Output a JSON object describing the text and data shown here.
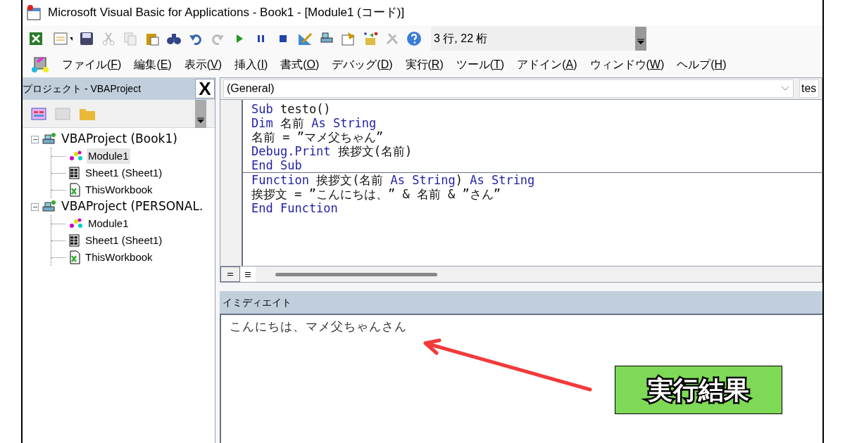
{
  "window": {
    "title": "Microsoft Visual Basic for Applications - Book1 - [Module1 (コード)]"
  },
  "toolbar": {
    "position": "3 行, 22 桁"
  },
  "menu": [
    {
      "prefix": "ファイル(",
      "key": "F",
      "suffix": ")"
    },
    {
      "prefix": "編集(",
      "key": "E",
      "suffix": ")"
    },
    {
      "prefix": "表示(",
      "key": "V",
      "suffix": ")"
    },
    {
      "prefix": "挿入(",
      "key": "I",
      "suffix": ")"
    },
    {
      "prefix": "書式(",
      "key": "O",
      "suffix": ")"
    },
    {
      "prefix": "デバッグ(",
      "key": "D",
      "suffix": ")"
    },
    {
      "prefix": "実行(",
      "key": "R",
      "suffix": ")"
    },
    {
      "prefix": "ツール(",
      "key": "T",
      "suffix": ")"
    },
    {
      "prefix": "アドイン(",
      "key": "A",
      "suffix": ")"
    },
    {
      "prefix": "ウィンドウ(",
      "key": "W",
      "suffix": ")"
    },
    {
      "prefix": "ヘルプ(",
      "key": "H",
      "suffix": ")"
    }
  ],
  "project_panel": {
    "title": "プロジェクト - VBAProject",
    "close": "X",
    "tree": [
      {
        "label": "VBAProject (Book1)",
        "kind": "project",
        "expanded": true,
        "selected": false,
        "children": [
          {
            "label": "Module1",
            "kind": "module",
            "selected": true
          },
          {
            "label": "Sheet1 (Sheet1)",
            "kind": "sheet",
            "selected": false
          },
          {
            "label": "ThisWorkbook",
            "kind": "workbook",
            "selected": false
          }
        ]
      },
      {
        "label": "VBAProject (PERSONAL.",
        "kind": "project",
        "expanded": true,
        "selected": false,
        "children": [
          {
            "label": "Module1",
            "kind": "module",
            "selected": false
          },
          {
            "label": "Sheet1 (Sheet1)",
            "kind": "sheet",
            "selected": false
          },
          {
            "label": "ThisWorkbook",
            "kind": "workbook",
            "selected": false
          }
        ]
      }
    ]
  },
  "code_window": {
    "object": "(General)",
    "procedure": "tes",
    "procedures": [
      [
        [
          {
            "text": "Sub",
            "keyword": true
          },
          {
            "text": " testo()",
            "keyword": false
          }
        ],
        [
          {
            "text": "Dim",
            "keyword": true
          },
          {
            "text": " 名前 ",
            "keyword": false
          },
          {
            "text": "As String",
            "keyword": true
          }
        ],
        [
          {
            "text": "名前 = ”マメ父ちゃん”",
            "keyword": false
          }
        ],
        [
          {
            "text": "Debug.Print",
            "keyword": true
          },
          {
            "text": " 挨拶文(名前)",
            "keyword": false
          }
        ],
        [
          {
            "text": "End Sub",
            "keyword": true
          }
        ]
      ],
      [
        [
          {
            "text": "Function",
            "keyword": true
          },
          {
            "text": " 挨拶文(名前 ",
            "keyword": false
          },
          {
            "text": "As String",
            "keyword": true
          },
          {
            "text": ") ",
            "keyword": false
          },
          {
            "text": "As String",
            "keyword": true
          }
        ],
        [
          {
            "text": "挨拶文 = ”こんにちは、” & 名前 & ”さん”",
            "keyword": false
          }
        ],
        [
          {
            "text": "End Function",
            "keyword": true
          }
        ]
      ]
    ]
  },
  "immediate": {
    "title": "イミディエイト",
    "output": "こんにちは、マメ父ちゃんさん"
  },
  "annotation": {
    "label": "実行結果"
  }
}
